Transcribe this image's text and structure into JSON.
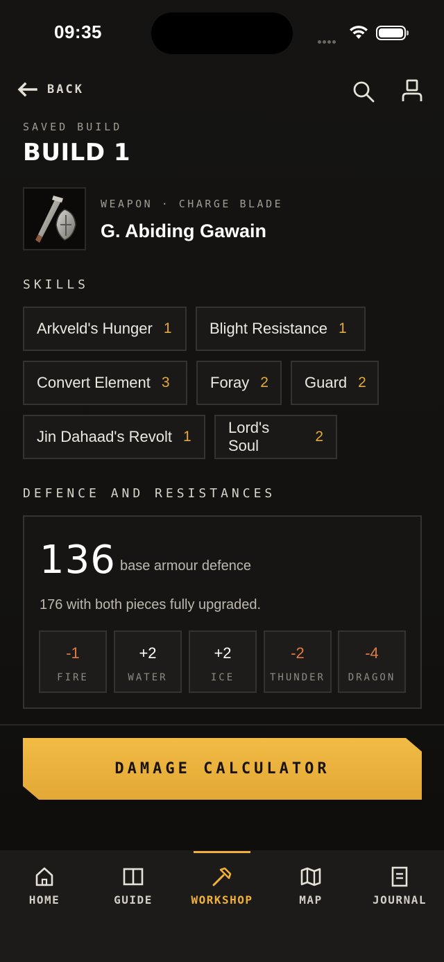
{
  "status": {
    "time": "09:35"
  },
  "nav": {
    "back_label": "BACK"
  },
  "build": {
    "saved_label": "SAVED BUILD",
    "title": "BUILD 1"
  },
  "weapon": {
    "meta": "WEAPON · CHARGE BLADE",
    "name": "G. Abiding Gawain"
  },
  "skills": {
    "label": "SKILLS",
    "items": [
      {
        "name": "Arkveld's Hunger",
        "level": "1"
      },
      {
        "name": "Blight Resistance",
        "level": "1"
      },
      {
        "name": "Convert Element",
        "level": "3"
      },
      {
        "name": "Foray",
        "level": "2"
      },
      {
        "name": "Guard",
        "level": "2"
      },
      {
        "name": "Jin Dahaad's Revolt",
        "level": "1"
      },
      {
        "name": "Lord's Soul",
        "level": "2"
      }
    ]
  },
  "defence": {
    "label": "DEFENCE AND RESISTANCES",
    "value": "136",
    "caption": "base armour defence",
    "upgrade_note": "176 with both pieces fully upgraded.",
    "resistances": [
      {
        "value": "-1",
        "name": "FIRE"
      },
      {
        "value": "+2",
        "name": "WATER"
      },
      {
        "value": "+2",
        "name": "ICE"
      },
      {
        "value": "-2",
        "name": "THUNDER"
      },
      {
        "value": "-4",
        "name": "DRAGON"
      }
    ]
  },
  "cta": {
    "label": "DAMAGE CALCULATOR"
  },
  "tabs": [
    {
      "label": "HOME",
      "icon": "home-icon"
    },
    {
      "label": "GUIDE",
      "icon": "guide-icon"
    },
    {
      "label": "WORKSHOP",
      "icon": "workshop-icon",
      "active": true
    },
    {
      "label": "MAP",
      "icon": "map-icon"
    },
    {
      "label": "JOURNAL",
      "icon": "journal-icon"
    }
  ],
  "colors": {
    "accent": "#f0b13a",
    "negative": "#e07a45",
    "background": "#121110"
  }
}
